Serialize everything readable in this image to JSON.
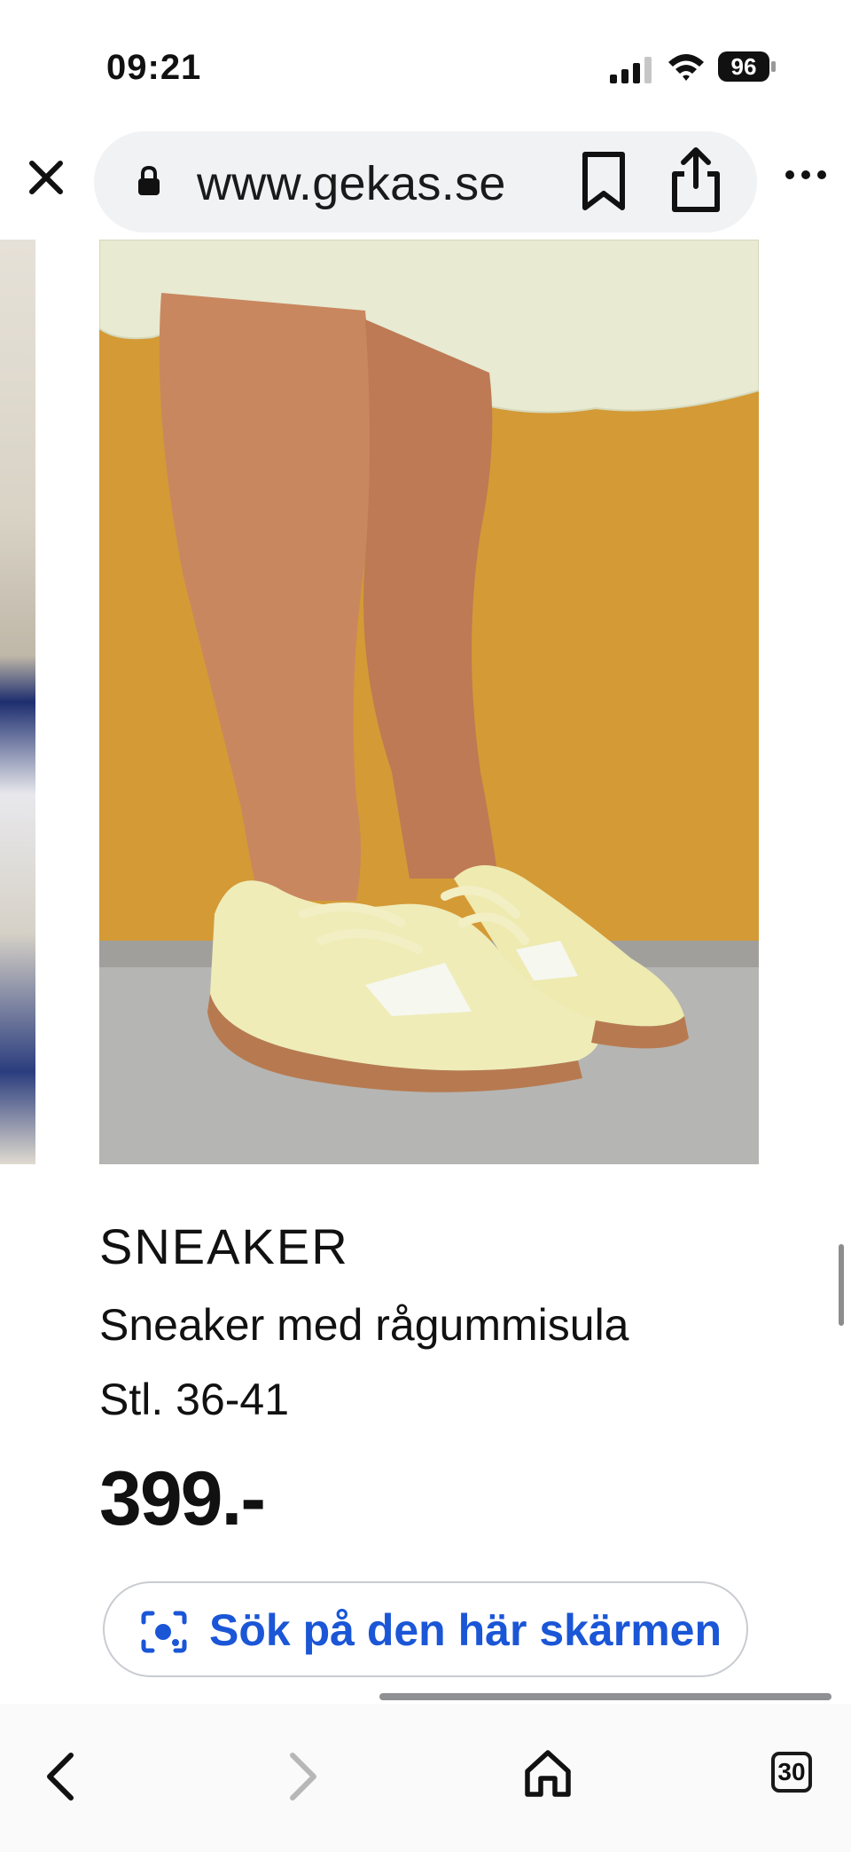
{
  "status_bar": {
    "time": "09:21",
    "battery": "96"
  },
  "browser": {
    "url": "www.gekas.se"
  },
  "product": {
    "name": "SNEAKER",
    "description": "Sneaker med rågummisula",
    "size": "Stl. 36-41",
    "price": "399.-"
  },
  "lens_button": {
    "label": "Sök på den här skärmen"
  },
  "toolbar": {
    "tab_count": "30"
  },
  "colors": {
    "accent": "#1a56d6",
    "wall": "#d99f3a"
  },
  "icons": [
    "signal-icon",
    "wifi-icon",
    "battery-icon",
    "close-icon",
    "lock-icon",
    "bookmark-icon",
    "share-icon",
    "more-icon",
    "lens-icon",
    "back-icon",
    "forward-icon",
    "home-icon",
    "tabs-icon"
  ]
}
